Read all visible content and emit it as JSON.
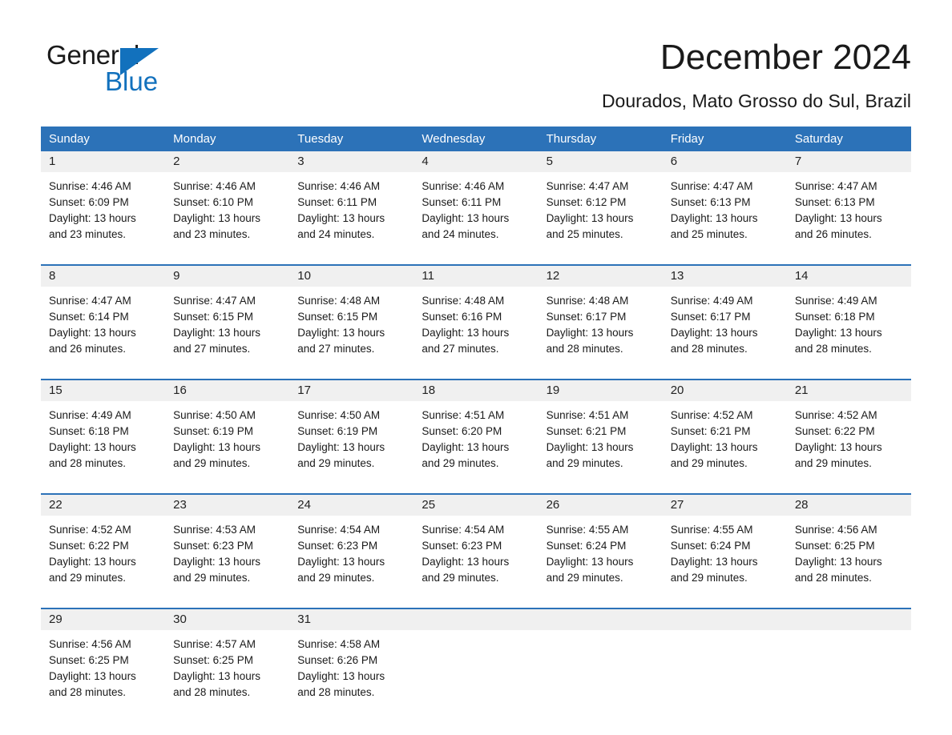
{
  "brand": {
    "name_part1": "General",
    "name_part2": "Blue",
    "triangle_color": "#1271bd"
  },
  "header": {
    "month_title": "December 2024",
    "location": "Dourados, Mato Grosso do Sul, Brazil"
  },
  "theme": {
    "header_blue": "#2c72b8",
    "date_strip_gray": "#f0f0f0",
    "text_color": "#1a1a1a",
    "page_background": "#ffffff"
  },
  "calendar": {
    "weekdays": [
      "Sunday",
      "Monday",
      "Tuesday",
      "Wednesday",
      "Thursday",
      "Friday",
      "Saturday"
    ],
    "weeks": [
      [
        {
          "day": "1",
          "sunrise": "Sunrise: 4:46 AM",
          "sunset": "Sunset: 6:09 PM",
          "daylight_line1": "Daylight: 13 hours",
          "daylight_line2": "and 23 minutes."
        },
        {
          "day": "2",
          "sunrise": "Sunrise: 4:46 AM",
          "sunset": "Sunset: 6:10 PM",
          "daylight_line1": "Daylight: 13 hours",
          "daylight_line2": "and 23 minutes."
        },
        {
          "day": "3",
          "sunrise": "Sunrise: 4:46 AM",
          "sunset": "Sunset: 6:11 PM",
          "daylight_line1": "Daylight: 13 hours",
          "daylight_line2": "and 24 minutes."
        },
        {
          "day": "4",
          "sunrise": "Sunrise: 4:46 AM",
          "sunset": "Sunset: 6:11 PM",
          "daylight_line1": "Daylight: 13 hours",
          "daylight_line2": "and 24 minutes."
        },
        {
          "day": "5",
          "sunrise": "Sunrise: 4:47 AM",
          "sunset": "Sunset: 6:12 PM",
          "daylight_line1": "Daylight: 13 hours",
          "daylight_line2": "and 25 minutes."
        },
        {
          "day": "6",
          "sunrise": "Sunrise: 4:47 AM",
          "sunset": "Sunset: 6:13 PM",
          "daylight_line1": "Daylight: 13 hours",
          "daylight_line2": "and 25 minutes."
        },
        {
          "day": "7",
          "sunrise": "Sunrise: 4:47 AM",
          "sunset": "Sunset: 6:13 PM",
          "daylight_line1": "Daylight: 13 hours",
          "daylight_line2": "and 26 minutes."
        }
      ],
      [
        {
          "day": "8",
          "sunrise": "Sunrise: 4:47 AM",
          "sunset": "Sunset: 6:14 PM",
          "daylight_line1": "Daylight: 13 hours",
          "daylight_line2": "and 26 minutes."
        },
        {
          "day": "9",
          "sunrise": "Sunrise: 4:47 AM",
          "sunset": "Sunset: 6:15 PM",
          "daylight_line1": "Daylight: 13 hours",
          "daylight_line2": "and 27 minutes."
        },
        {
          "day": "10",
          "sunrise": "Sunrise: 4:48 AM",
          "sunset": "Sunset: 6:15 PM",
          "daylight_line1": "Daylight: 13 hours",
          "daylight_line2": "and 27 minutes."
        },
        {
          "day": "11",
          "sunrise": "Sunrise: 4:48 AM",
          "sunset": "Sunset: 6:16 PM",
          "daylight_line1": "Daylight: 13 hours",
          "daylight_line2": "and 27 minutes."
        },
        {
          "day": "12",
          "sunrise": "Sunrise: 4:48 AM",
          "sunset": "Sunset: 6:17 PM",
          "daylight_line1": "Daylight: 13 hours",
          "daylight_line2": "and 28 minutes."
        },
        {
          "day": "13",
          "sunrise": "Sunrise: 4:49 AM",
          "sunset": "Sunset: 6:17 PM",
          "daylight_line1": "Daylight: 13 hours",
          "daylight_line2": "and 28 minutes."
        },
        {
          "day": "14",
          "sunrise": "Sunrise: 4:49 AM",
          "sunset": "Sunset: 6:18 PM",
          "daylight_line1": "Daylight: 13 hours",
          "daylight_line2": "and 28 minutes."
        }
      ],
      [
        {
          "day": "15",
          "sunrise": "Sunrise: 4:49 AM",
          "sunset": "Sunset: 6:18 PM",
          "daylight_line1": "Daylight: 13 hours",
          "daylight_line2": "and 28 minutes."
        },
        {
          "day": "16",
          "sunrise": "Sunrise: 4:50 AM",
          "sunset": "Sunset: 6:19 PM",
          "daylight_line1": "Daylight: 13 hours",
          "daylight_line2": "and 29 minutes."
        },
        {
          "day": "17",
          "sunrise": "Sunrise: 4:50 AM",
          "sunset": "Sunset: 6:19 PM",
          "daylight_line1": "Daylight: 13 hours",
          "daylight_line2": "and 29 minutes."
        },
        {
          "day": "18",
          "sunrise": "Sunrise: 4:51 AM",
          "sunset": "Sunset: 6:20 PM",
          "daylight_line1": "Daylight: 13 hours",
          "daylight_line2": "and 29 minutes."
        },
        {
          "day": "19",
          "sunrise": "Sunrise: 4:51 AM",
          "sunset": "Sunset: 6:21 PM",
          "daylight_line1": "Daylight: 13 hours",
          "daylight_line2": "and 29 minutes."
        },
        {
          "day": "20",
          "sunrise": "Sunrise: 4:52 AM",
          "sunset": "Sunset: 6:21 PM",
          "daylight_line1": "Daylight: 13 hours",
          "daylight_line2": "and 29 minutes."
        },
        {
          "day": "21",
          "sunrise": "Sunrise: 4:52 AM",
          "sunset": "Sunset: 6:22 PM",
          "daylight_line1": "Daylight: 13 hours",
          "daylight_line2": "and 29 minutes."
        }
      ],
      [
        {
          "day": "22",
          "sunrise": "Sunrise: 4:52 AM",
          "sunset": "Sunset: 6:22 PM",
          "daylight_line1": "Daylight: 13 hours",
          "daylight_line2": "and 29 minutes."
        },
        {
          "day": "23",
          "sunrise": "Sunrise: 4:53 AM",
          "sunset": "Sunset: 6:23 PM",
          "daylight_line1": "Daylight: 13 hours",
          "daylight_line2": "and 29 minutes."
        },
        {
          "day": "24",
          "sunrise": "Sunrise: 4:54 AM",
          "sunset": "Sunset: 6:23 PM",
          "daylight_line1": "Daylight: 13 hours",
          "daylight_line2": "and 29 minutes."
        },
        {
          "day": "25",
          "sunrise": "Sunrise: 4:54 AM",
          "sunset": "Sunset: 6:23 PM",
          "daylight_line1": "Daylight: 13 hours",
          "daylight_line2": "and 29 minutes."
        },
        {
          "day": "26",
          "sunrise": "Sunrise: 4:55 AM",
          "sunset": "Sunset: 6:24 PM",
          "daylight_line1": "Daylight: 13 hours",
          "daylight_line2": "and 29 minutes."
        },
        {
          "day": "27",
          "sunrise": "Sunrise: 4:55 AM",
          "sunset": "Sunset: 6:24 PM",
          "daylight_line1": "Daylight: 13 hours",
          "daylight_line2": "and 29 minutes."
        },
        {
          "day": "28",
          "sunrise": "Sunrise: 4:56 AM",
          "sunset": "Sunset: 6:25 PM",
          "daylight_line1": "Daylight: 13 hours",
          "daylight_line2": "and 28 minutes."
        }
      ],
      [
        {
          "day": "29",
          "sunrise": "Sunrise: 4:56 AM",
          "sunset": "Sunset: 6:25 PM",
          "daylight_line1": "Daylight: 13 hours",
          "daylight_line2": "and 28 minutes."
        },
        {
          "day": "30",
          "sunrise": "Sunrise: 4:57 AM",
          "sunset": "Sunset: 6:25 PM",
          "daylight_line1": "Daylight: 13 hours",
          "daylight_line2": "and 28 minutes."
        },
        {
          "day": "31",
          "sunrise": "Sunrise: 4:58 AM",
          "sunset": "Sunset: 6:26 PM",
          "daylight_line1": "Daylight: 13 hours",
          "daylight_line2": "and 28 minutes."
        },
        {
          "day": "",
          "sunrise": "",
          "sunset": "",
          "daylight_line1": "",
          "daylight_line2": ""
        },
        {
          "day": "",
          "sunrise": "",
          "sunset": "",
          "daylight_line1": "",
          "daylight_line2": ""
        },
        {
          "day": "",
          "sunrise": "",
          "sunset": "",
          "daylight_line1": "",
          "daylight_line2": ""
        },
        {
          "day": "",
          "sunrise": "",
          "sunset": "",
          "daylight_line1": "",
          "daylight_line2": ""
        }
      ]
    ]
  }
}
